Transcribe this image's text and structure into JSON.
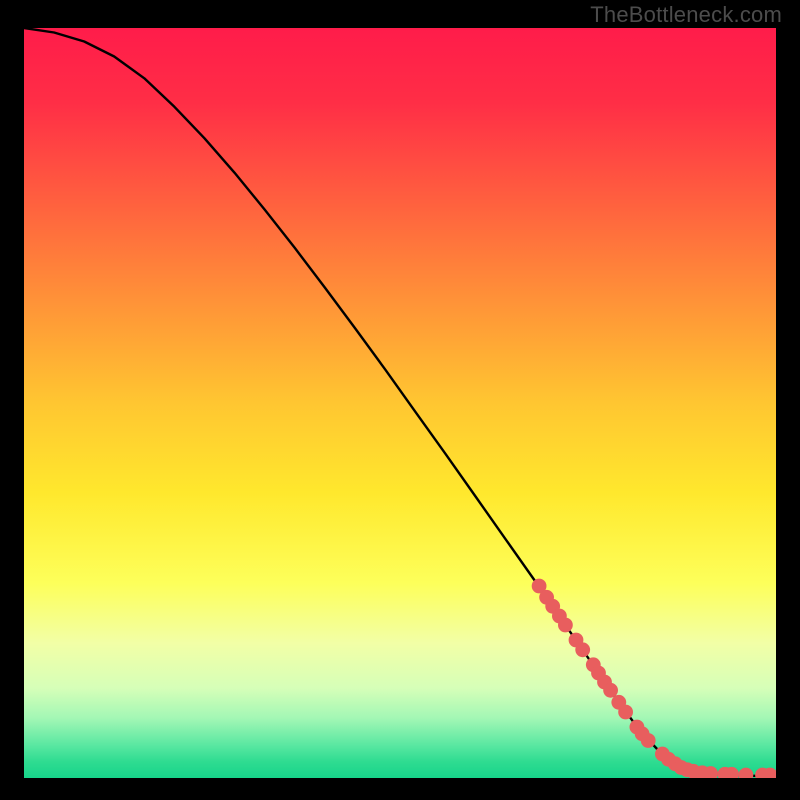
{
  "watermark": "TheBottleneck.com",
  "colors": {
    "bg": "#000000",
    "curve": "#000000",
    "marker_fill": "#E85E5E",
    "marker_stroke": "#C94F4F",
    "gradient_stops": [
      {
        "offset": 0.0,
        "color": "#FF1C4A"
      },
      {
        "offset": 0.1,
        "color": "#FF2E46"
      },
      {
        "offset": 0.3,
        "color": "#FF7A3B"
      },
      {
        "offset": 0.5,
        "color": "#FFC631"
      },
      {
        "offset": 0.62,
        "color": "#FFE82D"
      },
      {
        "offset": 0.74,
        "color": "#FDFF5A"
      },
      {
        "offset": 0.82,
        "color": "#F2FFA6"
      },
      {
        "offset": 0.88,
        "color": "#D6FFB8"
      },
      {
        "offset": 0.92,
        "color": "#A3F7B5"
      },
      {
        "offset": 0.955,
        "color": "#5CE8A2"
      },
      {
        "offset": 0.978,
        "color": "#2FDC91"
      },
      {
        "offset": 1.0,
        "color": "#17D48A"
      }
    ]
  },
  "chart_data": {
    "type": "line",
    "title": "",
    "xlabel": "",
    "ylabel": "",
    "xlim": [
      0,
      100
    ],
    "ylim": [
      0,
      100
    ],
    "series": [
      {
        "name": "curve",
        "x": [
          0,
          4,
          8,
          12,
          16,
          20,
          24,
          28,
          32,
          36,
          40,
          44,
          48,
          52,
          56,
          60,
          64,
          68,
          72,
          76,
          79,
          82,
          85,
          88,
          91,
          94,
          97,
          100
        ],
        "y": [
          100,
          99.4,
          98.2,
          96.2,
          93.3,
          89.5,
          85.3,
          80.7,
          75.8,
          70.7,
          65.4,
          60.0,
          54.5,
          48.9,
          43.3,
          37.6,
          31.9,
          26.2,
          20.4,
          14.6,
          10.2,
          6.2,
          3.0,
          1.2,
          0.6,
          0.4,
          0.3,
          0.3
        ]
      }
    ],
    "markers": [
      {
        "x": 68.5,
        "y": 25.6
      },
      {
        "x": 69.5,
        "y": 24.1
      },
      {
        "x": 70.3,
        "y": 22.9
      },
      {
        "x": 71.2,
        "y": 21.6
      },
      {
        "x": 72.0,
        "y": 20.4
      },
      {
        "x": 73.4,
        "y": 18.4
      },
      {
        "x": 74.3,
        "y": 17.1
      },
      {
        "x": 75.7,
        "y": 15.1
      },
      {
        "x": 76.4,
        "y": 14.0
      },
      {
        "x": 77.2,
        "y": 12.8
      },
      {
        "x": 78.0,
        "y": 11.7
      },
      {
        "x": 79.1,
        "y": 10.1
      },
      {
        "x": 80.0,
        "y": 8.8
      },
      {
        "x": 81.5,
        "y": 6.8
      },
      {
        "x": 82.2,
        "y": 5.9
      },
      {
        "x": 83.0,
        "y": 5.0
      },
      {
        "x": 84.9,
        "y": 3.2
      },
      {
        "x": 85.7,
        "y": 2.5
      },
      {
        "x": 86.6,
        "y": 1.9
      },
      {
        "x": 87.4,
        "y": 1.4
      },
      {
        "x": 88.2,
        "y": 1.1
      },
      {
        "x": 89.0,
        "y": 0.9
      },
      {
        "x": 90.2,
        "y": 0.7
      },
      {
        "x": 91.3,
        "y": 0.6
      },
      {
        "x": 93.2,
        "y": 0.5
      },
      {
        "x": 94.1,
        "y": 0.5
      },
      {
        "x": 96.0,
        "y": 0.4
      },
      {
        "x": 98.2,
        "y": 0.4
      },
      {
        "x": 99.2,
        "y": 0.4
      }
    ]
  }
}
